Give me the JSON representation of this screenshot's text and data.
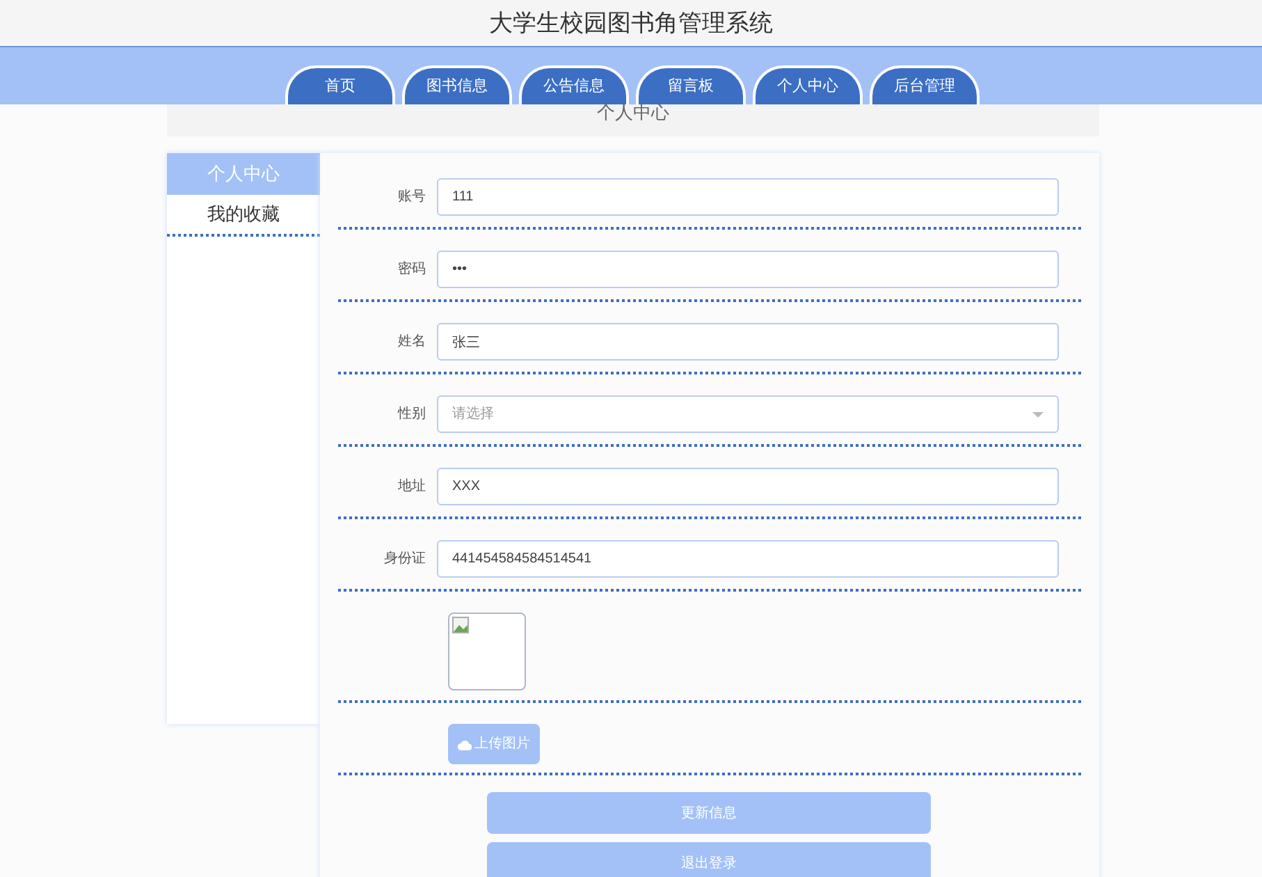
{
  "header": {
    "title": "大学生校园图书角管理系统"
  },
  "nav": [
    {
      "label": "首页"
    },
    {
      "label": "图书信息"
    },
    {
      "label": "公告信息"
    },
    {
      "label": "留言板"
    },
    {
      "label": "个人中心"
    },
    {
      "label": "后台管理"
    }
  ],
  "page_heading": "个人中心",
  "sidebar": {
    "items": [
      {
        "label": "个人中心",
        "selected": true
      },
      {
        "label": "我的收藏",
        "selected": false
      }
    ]
  },
  "form": {
    "fields": [
      {
        "kind": "text",
        "label": "账号",
        "value": "111"
      },
      {
        "kind": "password",
        "label": "密码",
        "value": "•••"
      },
      {
        "kind": "text",
        "label": "姓名",
        "value": "张三"
      },
      {
        "kind": "select",
        "label": "性别",
        "placeholder": "请选择"
      },
      {
        "kind": "text",
        "label": "地址",
        "value": "XXX"
      },
      {
        "kind": "text",
        "label": "身份证",
        "value": "441454584584514541"
      }
    ],
    "upload_button": "上传图片",
    "buttons": [
      "更新信息",
      "退出登录"
    ]
  }
}
